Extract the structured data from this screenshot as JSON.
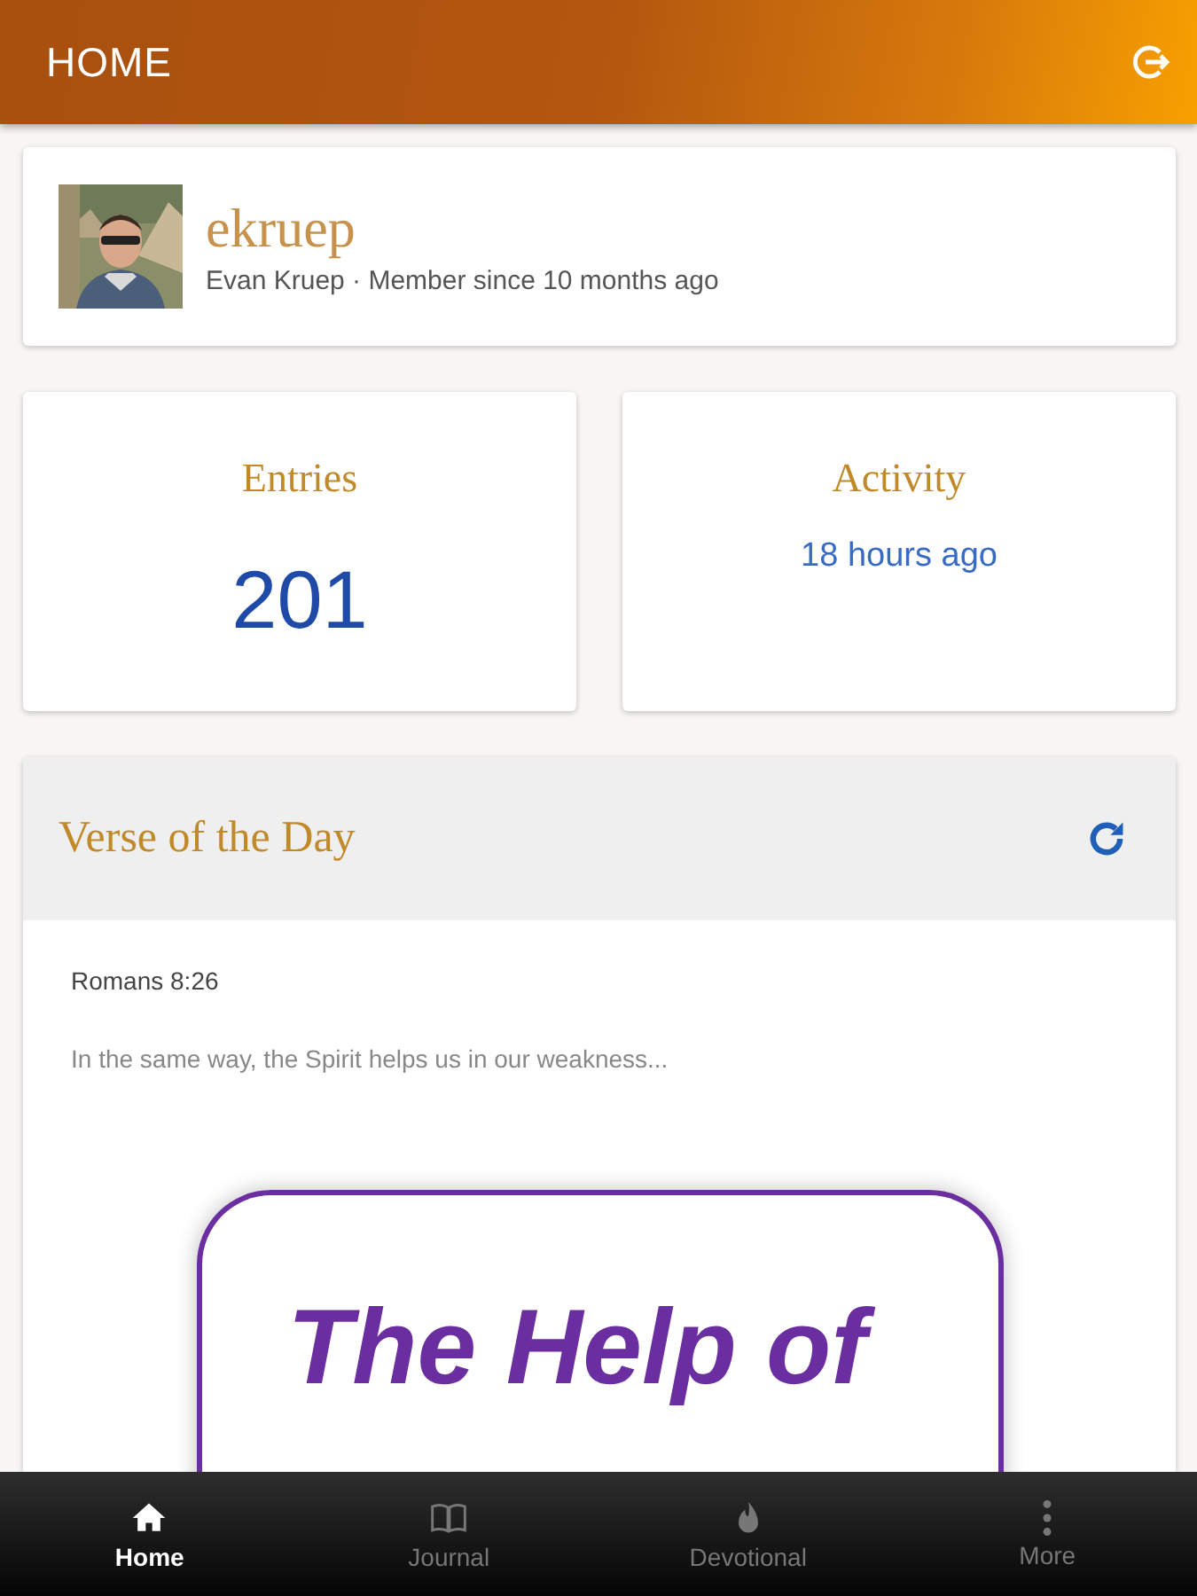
{
  "app_bar": {
    "title": "HOME"
  },
  "profile": {
    "username": "ekruep",
    "details": "Evan Kruep · Member since 10 months ago"
  },
  "stats": [
    {
      "label": "Entries",
      "value": "201",
      "kind": "big"
    },
    {
      "label": "Activity",
      "value": "18 hours ago",
      "kind": "small"
    }
  ],
  "verse_of_the_day": {
    "title": "Verse of the Day",
    "reference": "Romans 8:26",
    "excerpt": "In the same way, the Spirit helps us in our weakness...",
    "graphic_text": "The Help of"
  },
  "bottom_nav": [
    {
      "label": "Home",
      "selected": true
    },
    {
      "label": "Journal",
      "selected": false
    },
    {
      "label": "Devotional",
      "selected": false
    },
    {
      "label": "More",
      "selected": false
    }
  ]
}
